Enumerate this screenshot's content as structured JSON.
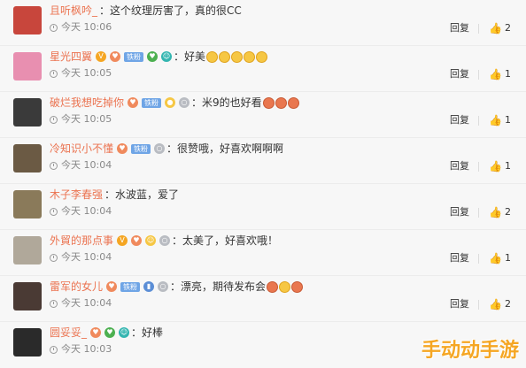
{
  "comments": [
    {
      "user": "且听枫吟_",
      "text": "：这个纹理厉害了，真的很CC",
      "time": "今天 10:06",
      "reply": "回复",
      "likes": "2",
      "badges": [],
      "emojis": 0,
      "avatar_color": "#c8463c"
    },
    {
      "user": "星光四翼",
      "text": "：好美",
      "time": "今天 10:05",
      "reply": "回复",
      "likes": "1",
      "badges": [
        "v",
        "fan",
        "铁粉",
        "heart",
        "grin"
      ],
      "emojis": 5,
      "avatar_color": "#e88fb0"
    },
    {
      "user": "破烂我想吃掉你",
      "text": "：米9的也好看",
      "time": "今天 10:05",
      "reply": "回复",
      "likes": "1",
      "badges": [
        "fan",
        "铁粉",
        "duck",
        "ring"
      ],
      "emojis": 3,
      "avatar_color": "#3a3a3a"
    },
    {
      "user": "冷知识小不懂",
      "text": "：很赞哦，好喜欢啊啊啊",
      "time": "今天 10:04",
      "reply": "回复",
      "likes": "1",
      "badges": [
        "fan",
        "铁粉",
        "ring"
      ],
      "emojis": 0,
      "avatar_color": "#6b5a44"
    },
    {
      "user": "木子李春强",
      "text": "：水波蓝，爱了",
      "time": "今天 10:04",
      "reply": "回复",
      "likes": "2",
      "badges": [],
      "emojis": 0,
      "avatar_color": "#8a7a5a"
    },
    {
      "user": "外貿的那点事",
      "text": "：太美了，好喜欢哦！",
      "time": "今天 10:04",
      "reply": "回复",
      "likes": "1",
      "badges": [
        "v",
        "fan",
        "cool",
        "ring"
      ],
      "emojis": 0,
      "avatar_color": "#b0a89a"
    },
    {
      "user": "雷军的女儿",
      "text": "：漂亮，期待发布会",
      "time": "今天 10:04",
      "reply": "回复",
      "likes": "2",
      "badges": [
        "fan",
        "铁粉",
        "phone",
        "ring"
      ],
      "emojis": 3,
      "avatar_color": "#4a3a34"
    },
    {
      "user": "圆妥妥_",
      "text": "：好棒",
      "time": "今天 10:03",
      "reply": "回复",
      "likes": "",
      "badges": [
        "fan",
        "heart",
        "grin"
      ],
      "emojis": 0,
      "avatar_color": "#2a2a2a"
    }
  ],
  "watermark": "手动动手游",
  "colors": {
    "username": "#eb7350",
    "badge": "#6fa5e6"
  }
}
